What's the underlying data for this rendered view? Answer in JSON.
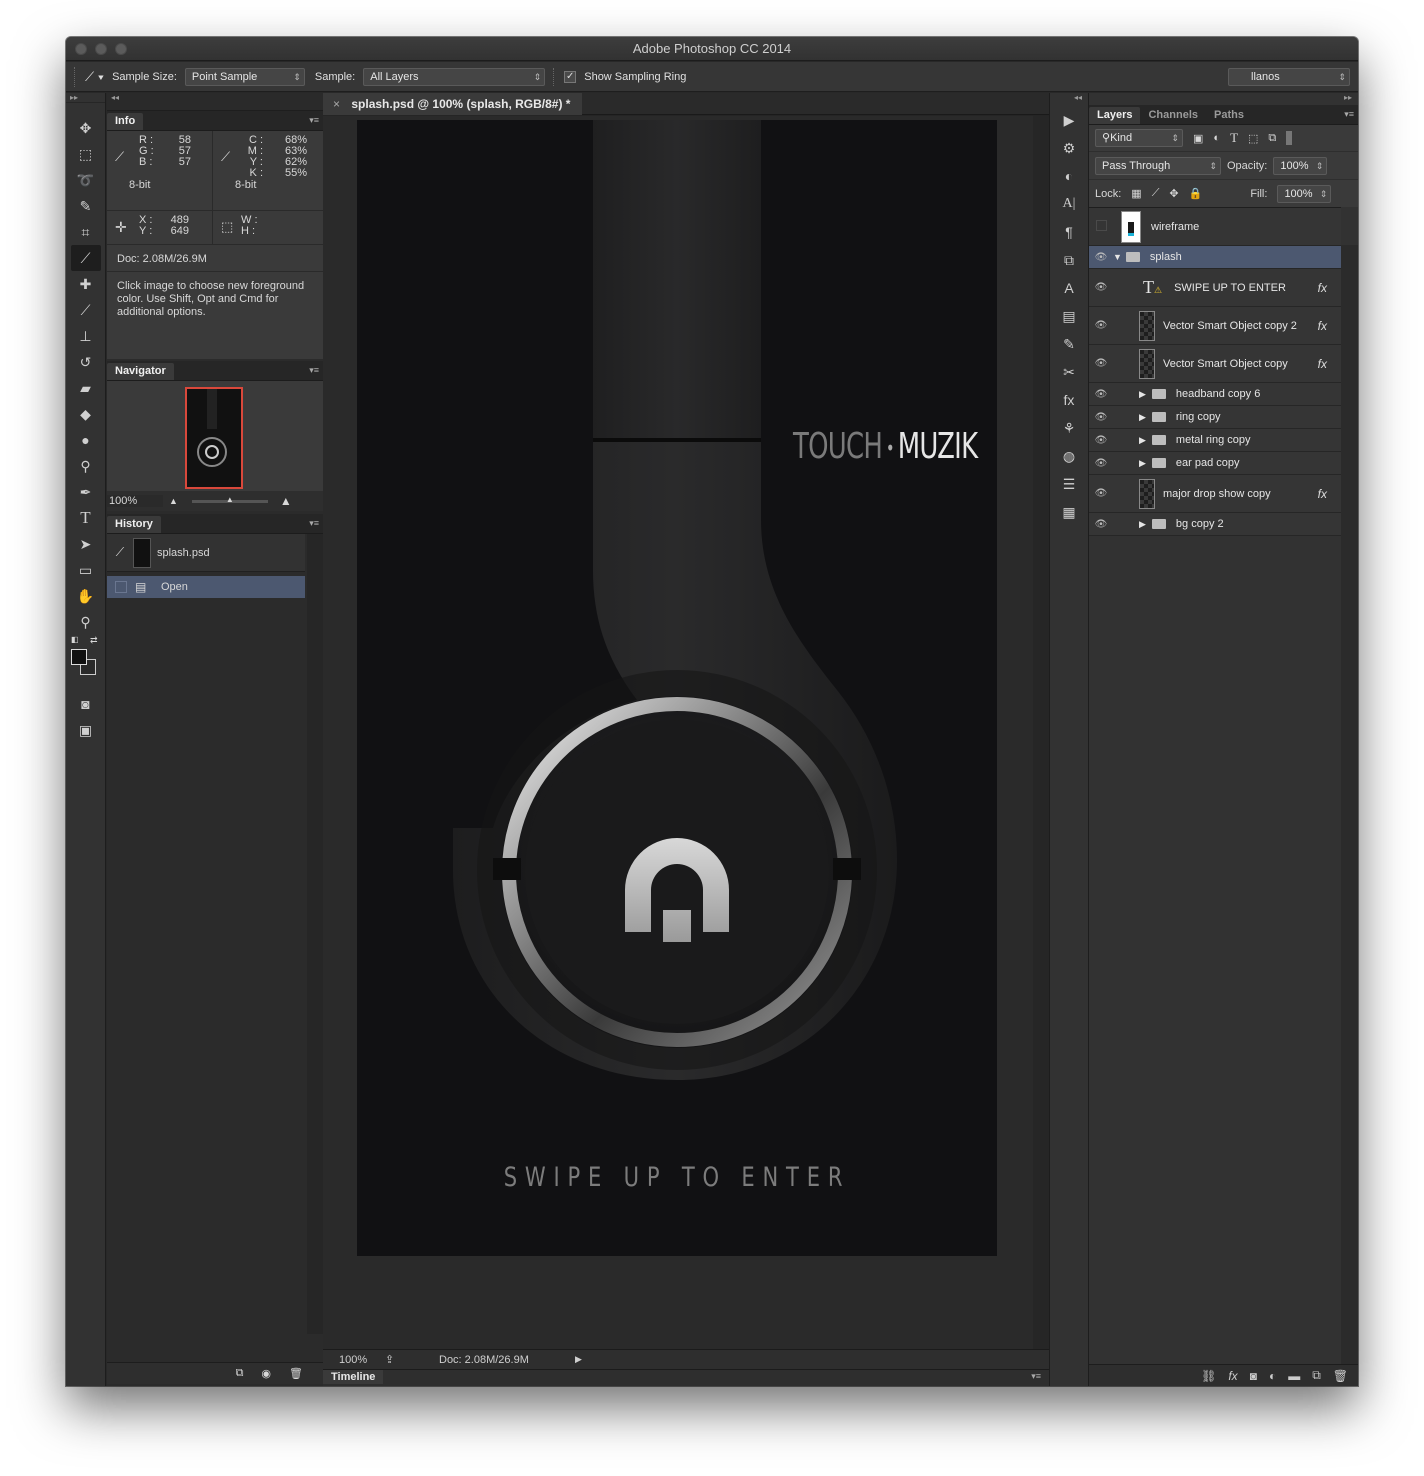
{
  "app": {
    "title": "Adobe Photoshop CC 2014"
  },
  "options_bar": {
    "sample_size_label": "Sample Size:",
    "sample_size_value": "Point Sample",
    "sample_label": "Sample:",
    "sample_value": "All Layers",
    "show_ring_label": "Show Sampling Ring",
    "workspace": "llanos"
  },
  "info_panel": {
    "tab": "Info",
    "r_label": "R :",
    "r": "58",
    "g_label": "G :",
    "g": "57",
    "b_label": "B :",
    "b": "57",
    "rgb_depth": "8-bit",
    "c_label": "C :",
    "c": "68%",
    "m_label": "M :",
    "m": "63%",
    "y_label": "Y :",
    "y": "62%",
    "k_label": "K :",
    "k": "55%",
    "cmyk_depth": "8-bit",
    "x_label": "X :",
    "x": "489",
    "yy_label": "Y :",
    "yy": "649",
    "w_label": "W :",
    "h_label": "H :",
    "doc": "Doc: 2.08M/26.9M",
    "hint": "Click image to choose new foreground color.  Use Shift, Opt and Cmd for additional options."
  },
  "navigator": {
    "tab": "Navigator",
    "zoom": "100%"
  },
  "history": {
    "tab": "History",
    "snapshot": "splash.psd",
    "states": [
      "Open"
    ]
  },
  "document": {
    "tab_title": "splash.psd @ 100% (splash, RGB/8#) *",
    "zoom": "100%",
    "doc_size": "Doc: 2.08M/26.9M",
    "timeline": "Timeline"
  },
  "artwork": {
    "brand_left": "TOUCH",
    "brand_right": "MUZIK",
    "cta": "SWIPE UP TO ENTER"
  },
  "layers_panel": {
    "tabs": [
      "Layers",
      "Channels",
      "Paths"
    ],
    "kind_filter": "Kind",
    "blend_mode": "Pass Through",
    "opacity_label": "Opacity:",
    "opacity": "100%",
    "lock_label": "Lock:",
    "fill_label": "Fill:",
    "fill": "100%",
    "layers": [
      {
        "name": "wireframe",
        "type": "image",
        "visible": false
      },
      {
        "name": "splash",
        "type": "group-open",
        "visible": true
      },
      {
        "name": "SWIPE UP TO ENTER",
        "type": "text",
        "visible": true,
        "fx": true
      },
      {
        "name": "Vector Smart Object copy 2",
        "type": "smart",
        "visible": true,
        "fx": true
      },
      {
        "name": "Vector Smart Object copy",
        "type": "smart",
        "visible": true,
        "fx": true
      },
      {
        "name": "headband copy 6",
        "type": "group",
        "visible": true
      },
      {
        "name": "ring copy",
        "type": "group",
        "visible": true
      },
      {
        "name": "metal ring copy",
        "type": "group",
        "visible": true
      },
      {
        "name": "ear pad copy",
        "type": "group",
        "visible": true
      },
      {
        "name": "major drop show copy",
        "type": "smart",
        "visible": true,
        "fx": true
      },
      {
        "name": "bg copy 2",
        "type": "group",
        "visible": true
      }
    ]
  },
  "colors": {
    "accent_selection": "#4c5870",
    "navigator_frame": "#d9483b"
  }
}
